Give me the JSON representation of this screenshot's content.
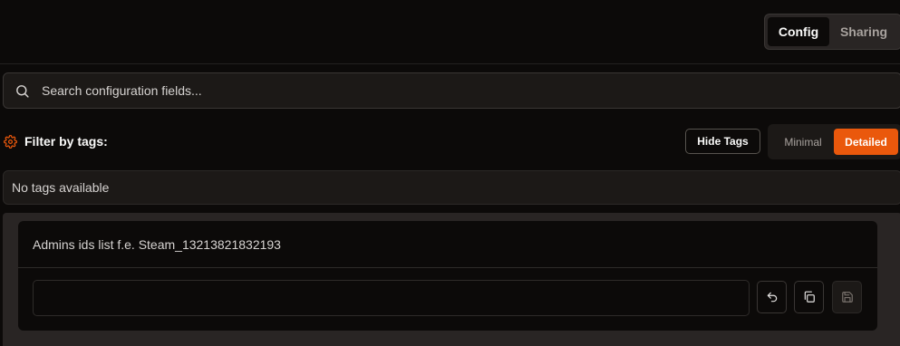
{
  "tabs": {
    "config_label": "Config",
    "sharing_label": "Sharing",
    "active": "Config"
  },
  "search": {
    "placeholder": "Search configuration fields...",
    "value": ""
  },
  "filter": {
    "label": "Filter by tags:",
    "hide_tags_label": "Hide Tags",
    "mode_minimal_label": "Minimal",
    "mode_detailed_label": "Detailed",
    "active_mode": "Detailed",
    "empty_message": "No tags available"
  },
  "field": {
    "description": "Admins ids list f.e. Steam_13213821832193",
    "value": "",
    "actions": [
      "undo-icon",
      "copy-icon",
      "save-icon"
    ]
  },
  "colors": {
    "accent": "#ea580c",
    "background": "#0c0a09",
    "panel": "#292524"
  }
}
